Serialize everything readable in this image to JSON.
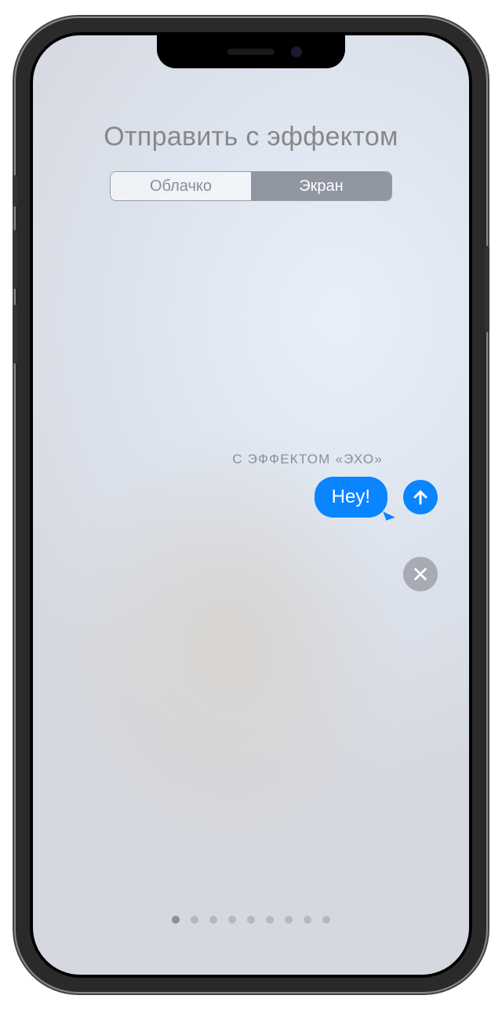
{
  "header": {
    "title": "Отправить с эффектом"
  },
  "segments": {
    "bubble": "Облачко",
    "screen": "Экран"
  },
  "effect": {
    "label": "С ЭФФЕКТОМ «ЭХО»"
  },
  "message": {
    "text": "Hey!"
  },
  "pager": {
    "total": 9,
    "active_index": 0
  },
  "colors": {
    "accent": "#0a84ff",
    "muted": "#8c8f99"
  }
}
